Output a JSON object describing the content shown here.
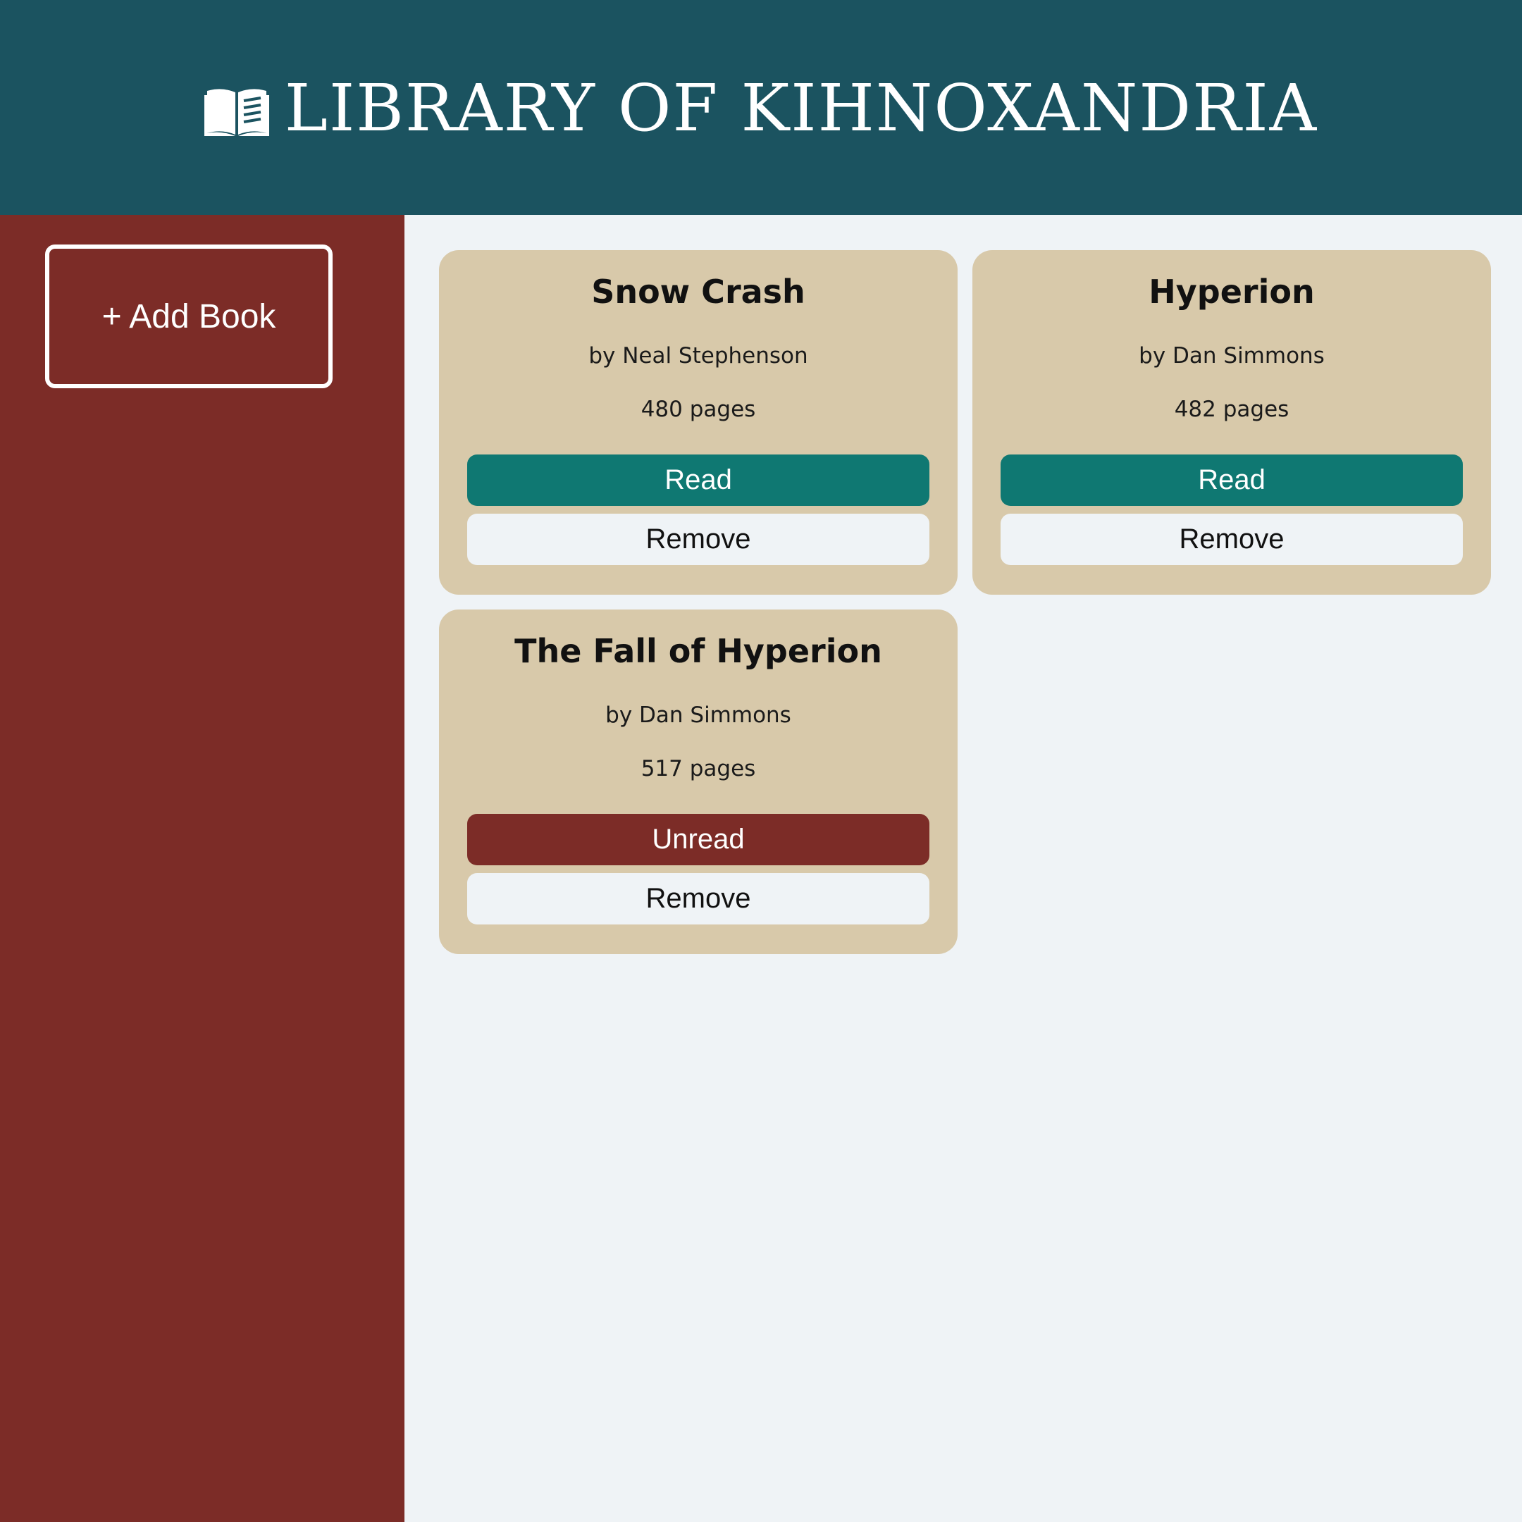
{
  "header": {
    "title": "LIBRARY OF KIHNOXANDRIA",
    "icon": "open-book-icon"
  },
  "sidebar": {
    "add_book_label": "+ Add Book"
  },
  "books": [
    {
      "title": "Snow Crash",
      "author": "by Neal Stephenson",
      "pages": "480 pages",
      "status_label": "Read",
      "status": "read",
      "remove_label": "Remove"
    },
    {
      "title": "Hyperion",
      "author": "by Dan Simmons",
      "pages": "482 pages",
      "status_label": "Read",
      "status": "read",
      "remove_label": "Remove"
    },
    {
      "title": "The Fall of Hyperion",
      "author": "by Dan Simmons",
      "pages": "517 pages",
      "status_label": "Unread",
      "status": "unread",
      "remove_label": "Remove"
    }
  ],
  "colors": {
    "header_bg": "#1b5360",
    "sidebar_bg": "#7c2c27",
    "main_bg": "#eff3f6",
    "card_bg": "#d8c9aa",
    "read_button": "#0f7872",
    "unread_button": "#7c2c27"
  }
}
